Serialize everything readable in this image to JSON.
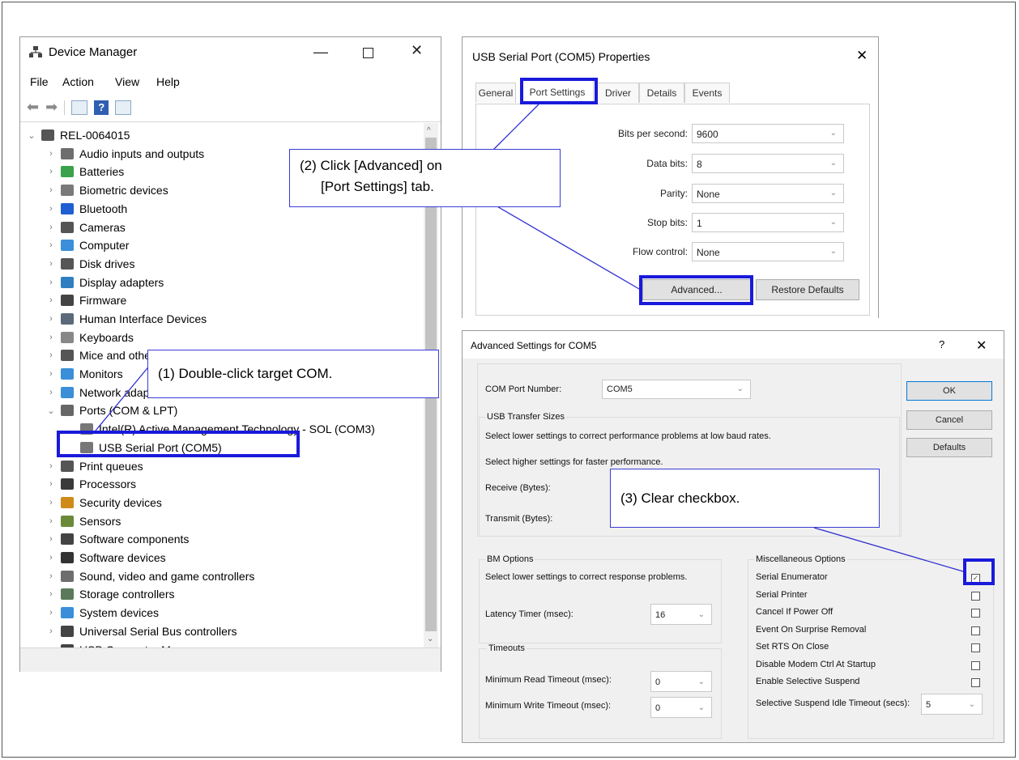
{
  "device_manager": {
    "title": "Device Manager",
    "menu": [
      "File",
      "Action",
      "View",
      "Help"
    ],
    "root": "REL-0064015",
    "categories": [
      {
        "label": "Audio inputs and outputs",
        "icon": "speaker-icon",
        "color": "#6e6e6e"
      },
      {
        "label": "Batteries",
        "icon": "battery-icon",
        "color": "#3aa24a"
      },
      {
        "label": "Biometric devices",
        "icon": "fingerprint-icon",
        "color": "#7a7a7a"
      },
      {
        "label": "Bluetooth",
        "icon": "bluetooth-icon",
        "color": "#1f5fd1"
      },
      {
        "label": "Cameras",
        "icon": "camera-icon",
        "color": "#555555"
      },
      {
        "label": "Computer",
        "icon": "monitor-icon",
        "color": "#3a8fd8"
      },
      {
        "label": "Disk drives",
        "icon": "disk-icon",
        "color": "#555555"
      },
      {
        "label": "Display adapters",
        "icon": "display-adapter-icon",
        "color": "#2f7fc0"
      },
      {
        "label": "Firmware",
        "icon": "chip-icon",
        "color": "#444444"
      },
      {
        "label": "Human Interface Devices",
        "icon": "hid-icon",
        "color": "#5a6a7a"
      },
      {
        "label": "Keyboards",
        "icon": "keyboard-icon",
        "color": "#888888"
      },
      {
        "label": "Mice and other pointing devices",
        "icon": "mouse-icon",
        "color": "#555555"
      },
      {
        "label": "Monitors",
        "icon": "monitor-icon",
        "color": "#3a8fd8"
      },
      {
        "label": "Network adapters",
        "icon": "network-icon",
        "color": "#3a8fd8"
      },
      {
        "label": "Ports (COM & LPT)",
        "icon": "port-icon",
        "color": "#666666"
      }
    ],
    "port_children": [
      "Intel(R) Active Management Technology - SOL (COM3)",
      "USB Serial Port (COM5)"
    ],
    "categories_after": [
      {
        "label": "Print queues",
        "icon": "printer-icon",
        "color": "#555555"
      },
      {
        "label": "Processors",
        "icon": "cpu-icon",
        "color": "#3a3a3a"
      },
      {
        "label": "Security devices",
        "icon": "security-icon",
        "color": "#d08a1a"
      },
      {
        "label": "Sensors",
        "icon": "sensor-icon",
        "color": "#6a8a3a"
      },
      {
        "label": "Software components",
        "icon": "component-icon",
        "color": "#444444"
      },
      {
        "label": "Software devices",
        "icon": "software-device-icon",
        "color": "#333333"
      },
      {
        "label": "Sound, video and game controllers",
        "icon": "speaker-icon",
        "color": "#6e6e6e"
      },
      {
        "label": "Storage controllers",
        "icon": "storage-icon",
        "color": "#5a7a5a"
      },
      {
        "label": "System devices",
        "icon": "folder-icon",
        "color": "#3a8fd8"
      },
      {
        "label": "Universal Serial Bus controllers",
        "icon": "usb-icon",
        "color": "#444444"
      },
      {
        "label": "USB Connector Managers",
        "icon": "usb-icon",
        "color": "#444444"
      }
    ]
  },
  "properties": {
    "title": "USB Serial Port (COM5) Properties",
    "tabs": [
      "General",
      "Port Settings",
      "Driver",
      "Details",
      "Events"
    ],
    "fields": [
      {
        "label": "Bits per second:",
        "value": "9600"
      },
      {
        "label": "Data bits:",
        "value": "8"
      },
      {
        "label": "Parity:",
        "value": "None"
      },
      {
        "label": "Stop bits:",
        "value": "1"
      },
      {
        "label": "Flow control:",
        "value": "None"
      }
    ],
    "advanced_btn": "Advanced...",
    "restore_btn": "Restore Defaults"
  },
  "advanced": {
    "title": "Advanced Settings for COM5",
    "help": "?",
    "com_port_label": "COM Port Number:",
    "com_port_value": "COM5",
    "usb_transfer": "USB Transfer Sizes",
    "usb_line1": "Select lower settings to correct performance problems at low baud rates.",
    "usb_line2": "Select higher settings for faster performance.",
    "receive": "Receive (Bytes):",
    "transmit": "Transmit (Bytes):",
    "bm_options": "BM Options",
    "bm_line": "Select lower settings to correct response problems.",
    "latency_label": "Latency Timer (msec):",
    "latency_value": "16",
    "timeouts": "Timeouts",
    "min_read": "Minimum Read Timeout (msec):",
    "min_read_value": "0",
    "min_write": "Minimum Write Timeout (msec):",
    "min_write_value": "0",
    "misc": "Miscellaneous Options",
    "misc_options": [
      {
        "label": "Serial Enumerator",
        "checked": true
      },
      {
        "label": "Serial Printer",
        "checked": false
      },
      {
        "label": "Cancel If Power Off",
        "checked": false
      },
      {
        "label": "Event On Surprise Removal",
        "checked": false
      },
      {
        "label": "Set RTS On Close",
        "checked": false
      },
      {
        "label": "Disable Modem Ctrl At Startup",
        "checked": false
      },
      {
        "label": "Enable Selective Suspend",
        "checked": false
      }
    ],
    "suspend_label": "Selective Suspend Idle Timeout (secs):",
    "suspend_value": "5",
    "ok": "OK",
    "cancel": "Cancel",
    "defaults": "Defaults"
  },
  "callouts": {
    "step1": "(1) Double-click target COM.",
    "step2_line1": "(2) Click [Advanced] on",
    "step2_line2": "[Port Settings] tab.",
    "step3": "(3) Clear checkbox."
  },
  "colors": {
    "highlight": "#1a1adb",
    "callout_line": "#2f2fd0"
  }
}
